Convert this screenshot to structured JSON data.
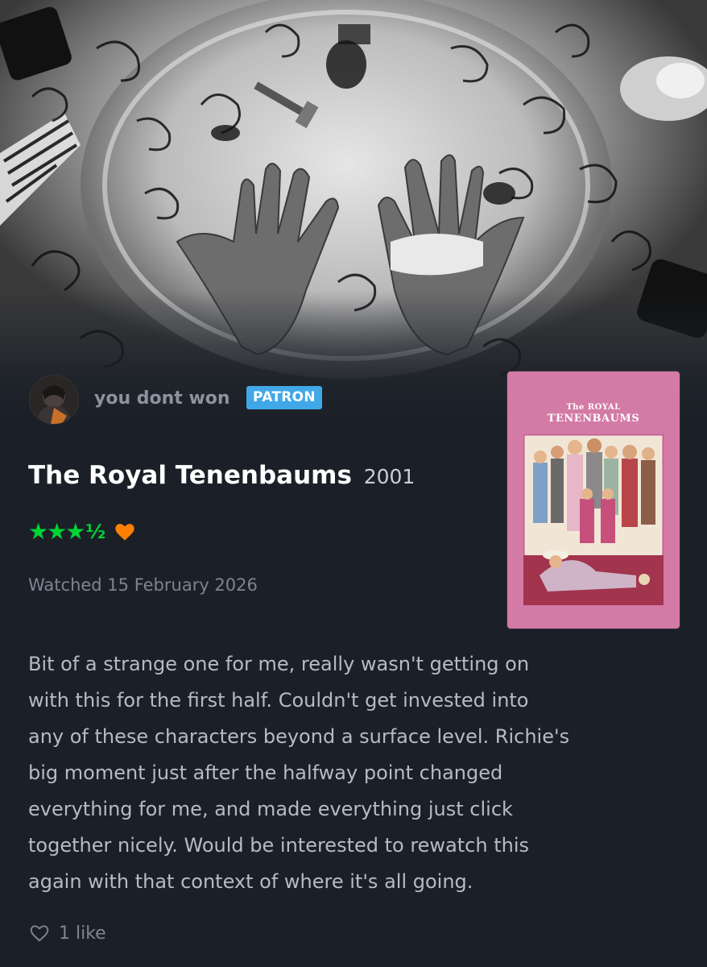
{
  "user": {
    "name": "you dont won",
    "badge": "PATRON"
  },
  "film": {
    "title": "The Royal Tenenbaums",
    "year": "2001",
    "poster_title_line1": "The ROYAL",
    "poster_title_line2": "TENENBAUMS"
  },
  "rating": {
    "stars_value": 3.5,
    "full_stars": "★★★",
    "half_star": "½",
    "liked": true
  },
  "watched_text": "Watched 15 February 2026",
  "review_lines": [
    "Bit of a strange one for me, really wasn't getting on",
    "with this for the first half. Couldn't get invested into",
    "any of these characters beyond a surface level. Richie's",
    "big moment just after the halfway point changed",
    "everything for me, and made everything just click",
    "together nicely. Would be interested to rewatch this",
    "again with that context of where it's all going."
  ],
  "likes": {
    "count_label": "1 like"
  },
  "colors": {
    "background": "#1b2028",
    "star_green": "#00d435",
    "heart_orange": "#ff8000",
    "patron_blue": "#40a8e8",
    "poster_pink": "#d37aa6"
  },
  "icons": {
    "rating_heart": "heart-icon",
    "like_heart": "heart-outline-icon"
  }
}
